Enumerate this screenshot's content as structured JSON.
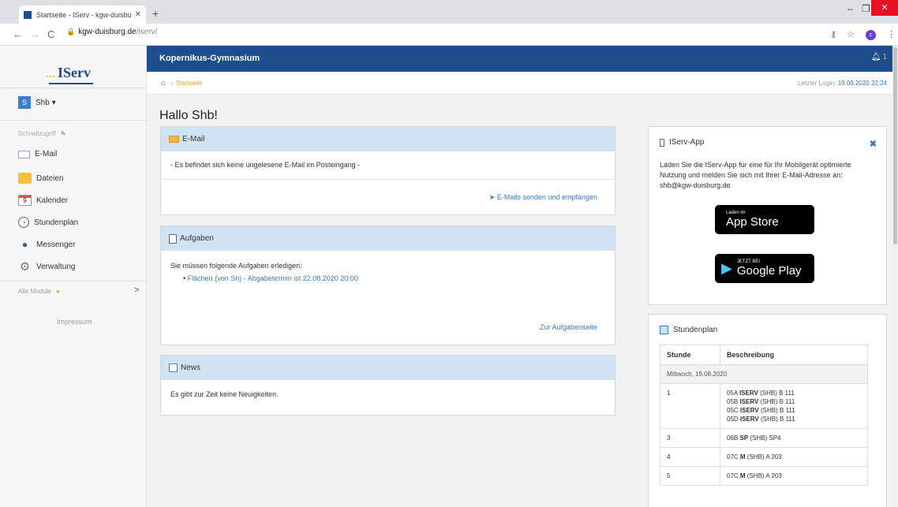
{
  "browser": {
    "tab_title": "Startseite - IServ - kgw-duisburg",
    "url_host": "kgw-duisburg.de",
    "url_path": "/iserv/",
    "profile_initial": "c"
  },
  "sidebar": {
    "logo": "IServ",
    "user": {
      "initial": "S",
      "name": "Shb ▾"
    },
    "quick_access": "Schnellzugriff",
    "items": [
      {
        "label": "E-Mail",
        "icon": "mail-icon"
      },
      {
        "label": "Dateien",
        "icon": "folder-icon"
      },
      {
        "label": "Kalender",
        "icon": "calendar-icon"
      },
      {
        "label": "Stundenplan",
        "icon": "clock-icon"
      },
      {
        "label": "Messenger",
        "icon": "chat-icon"
      },
      {
        "label": "Verwaltung",
        "icon": "gear-icon"
      }
    ],
    "all_modules": "Alle Module",
    "impressum": "Impressum"
  },
  "header": {
    "school": "Kopernikus-Gymnasium",
    "notification_count": "1",
    "breadcrumb": "Startseite",
    "last_login_label": "Letzter Login:",
    "last_login_value": "19.08.2020 22:24"
  },
  "main": {
    "greeting": "Hallo Shb!",
    "email": {
      "title": "E-Mail",
      "message": "- Es befindet sich keine ungelesene E-Mail im Posteingang -",
      "link": "E-Mails senden und empfangen"
    },
    "tasks": {
      "title": "Aufgaben",
      "intro": "Sie müssen folgende Aufgaben erledigen:",
      "item": "Flächen (von Sh) - Abgabetermin ist 22.08.2020 20:00",
      "link": "Zur Aufgabenseite"
    },
    "news": {
      "title": "News",
      "message": "Es gibt zur Zeit keine Neuigkeiten."
    }
  },
  "app_card": {
    "title": "IServ-App",
    "text": "Laden Sie die IServ-App für eine für Ihr Mobilgerät optimierte Nutzung und melden Sie sich mit Ihrer E-Mail-Adresse an: shb@kgw-duisburg.de",
    "appstore_small": "Laden im",
    "appstore_big": "App Store",
    "googleplay_small": "JETZT BEI",
    "googleplay_big": "Google Play"
  },
  "timetable": {
    "title": "Stundenplan",
    "col_hour": "Stunde",
    "col_desc": "Beschreibung",
    "day": "Mittwoch, 19.08.2020",
    "rows": [
      {
        "hour": "1",
        "lines": [
          {
            "pre": "05A ",
            "bold": "ISERV",
            "post": " (SHB) B 111"
          },
          {
            "pre": "05B ",
            "bold": "ISERV",
            "post": " (SHB) B 111"
          },
          {
            "pre": "05C ",
            "bold": "ISERV",
            "post": " (SHB) B 111"
          },
          {
            "pre": "05D ",
            "bold": "ISERV",
            "post": " (SHB) B 111"
          }
        ]
      },
      {
        "hour": "3",
        "lines": [
          {
            "pre": "06B ",
            "bold": "SP",
            "post": " (SHB) SP4"
          }
        ]
      },
      {
        "hour": "4",
        "lines": [
          {
            "pre": "07C ",
            "bold": "M",
            "post": " (SHB) A 203"
          }
        ]
      },
      {
        "hour": "5",
        "lines": [
          {
            "pre": "07C ",
            "bold": "M",
            "post": " (SHB) A 203"
          }
        ]
      }
    ]
  }
}
